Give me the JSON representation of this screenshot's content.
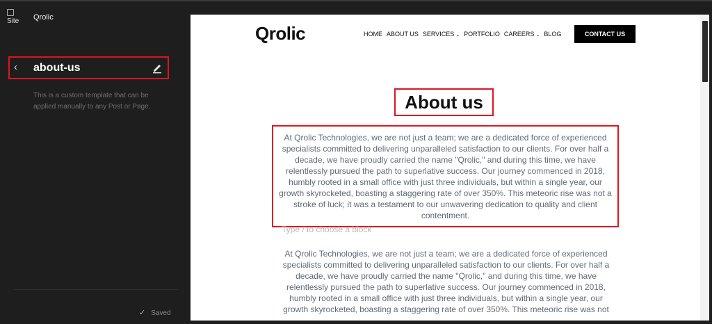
{
  "sidebar": {
    "site_icon_alt": "Site",
    "site_title": "Qrolic",
    "template_name": "about-us",
    "template_description": "This is a custom template that can be applied manually to any Post or Page.",
    "saved_label": "Saved"
  },
  "preview": {
    "logo": "Qrolic",
    "nav": [
      "HOME",
      "ABOUT US",
      "SERVICES",
      "PORTFOLIO",
      "CAREERS",
      "BLOG"
    ],
    "contact_button": "CONTACT US",
    "heading": "About us",
    "paragraph": "At Qrolic Technologies, we are not just a team; we are a dedicated force of experienced specialists committed to delivering unparalleled satisfaction to our clients. For over half a decade, we have proudly carried the name \"Qrolic,\" and during this time, we have relentlessly pursued the path to superlative success. Our journey commenced in 2018, humbly rooted in a small office with just three individuals, but within a single year, our growth skyrocketed, boasting a staggering rate of over 350%. This meteoric rise was not a stroke of luck; it was a testament to our unwavering dedication to quality and client contentment.",
    "block_placeholder": "Type / to choose a block",
    "paragraph2": "At Qrolic Technologies, we are not just a team; we are a dedicated force of experienced specialists committed to delivering unparalleled satisfaction to our clients. For over half a decade, we have proudly carried the name \"Qrolic,\" and during this time, we have relentlessly pursued the path to superlative success. Our journey commenced in 2018, humbly rooted in a small office with just three individuals, but within a single year, our growth skyrocketed, boasting a staggering rate of over 350%. This meteoric rise was not"
  },
  "colors": {
    "sidebar_bg": "#1e1e1e",
    "highlight": "#e0141e",
    "body_text": "#5f6b78"
  }
}
